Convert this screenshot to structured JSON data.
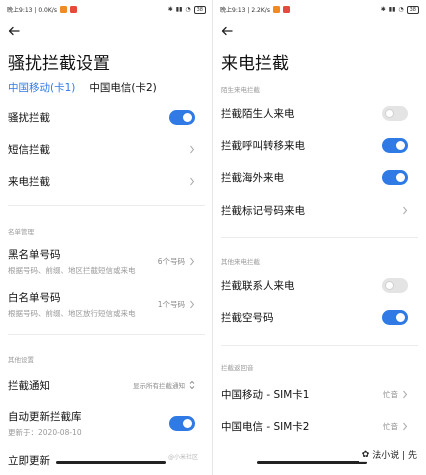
{
  "left": {
    "status": {
      "time": "晚上9:13",
      "speed": "0.0K/s",
      "battery": "38"
    },
    "title": "骚扰拦截设置",
    "sim_tabs": [
      "中国移动(卡1)",
      "中国电信(卡2)"
    ],
    "rows": {
      "harass": "骚扰拦截",
      "sms": "短信拦截",
      "call": "来电拦截"
    },
    "section_list": "名单管理",
    "blacklist": {
      "label": "黑名单号码",
      "sub": "根据号码、前缀、地区拦截短信或来电",
      "value": "6个号码"
    },
    "whitelist": {
      "label": "白名单号码",
      "sub": "根据号码、前缀、地区放行短信或来电",
      "value": "1个号码"
    },
    "section_other": "其他设置",
    "notify": {
      "label": "拦截通知",
      "value": "显示所有拦截通知"
    },
    "auto_update": {
      "label": "自动更新拦截库",
      "sub": "更新于：2020-08-10"
    },
    "update_now": "立即更新",
    "watermark": "@小米社区"
  },
  "right": {
    "status": {
      "time": "晚上9:13",
      "speed": "2.2K/s",
      "battery": "38"
    },
    "title": "来电拦截",
    "section_stranger": "陌生来电拦截",
    "stranger": "拦截陌生人来电",
    "forward": "拦截呼叫转移来电",
    "overseas": "拦截海外来电",
    "marked": "拦截标记号码来电",
    "section_other": "其他来电拦截",
    "contacts": "拦截联系人来电",
    "empty": "拦截空号码",
    "section_return": "拦截返回音",
    "sim1": {
      "label": "中国移动 - SIM卡1",
      "value": "忙音"
    },
    "sim2": {
      "label": "中国电信 - SIM卡2",
      "value": "忙音"
    },
    "badge": "法小说 | 先"
  },
  "colors": {
    "accent": "#2f7ae5"
  },
  "toggles": {
    "harass": true,
    "auto_update": true,
    "stranger": false,
    "forward": true,
    "overseas": true,
    "contacts": false,
    "empty": true
  }
}
